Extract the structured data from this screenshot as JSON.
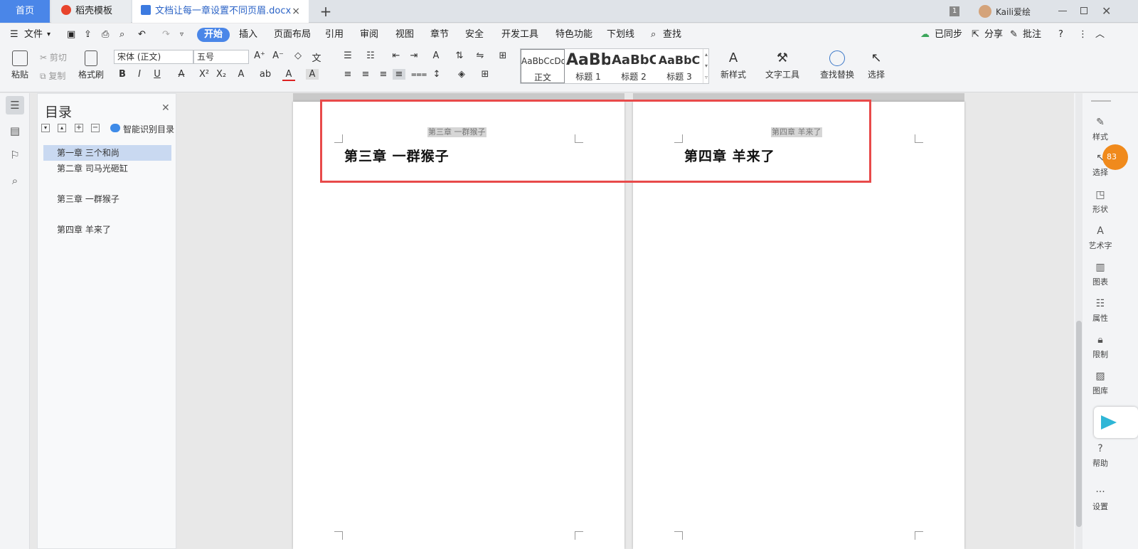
{
  "tabs": {
    "home": "首页",
    "templates": "稻壳模板",
    "document": "文档让每一章设置不同页眉.docx",
    "close": "×",
    "new_tab": "+"
  },
  "titlebar": {
    "badge": "1",
    "user": "Kaili爱绘"
  },
  "menu": {
    "file": "文件",
    "items": [
      "开始",
      "插入",
      "页面布局",
      "引用",
      "审阅",
      "视图",
      "章节",
      "安全",
      "开发工具",
      "特色功能",
      "下划线"
    ],
    "search": "查找",
    "sync": "已同步",
    "share": "分享",
    "comment": "批注"
  },
  "ribbon": {
    "paste": "粘贴",
    "cut": "剪切",
    "copy": "复制",
    "format_painter": "格式刷",
    "font_name": "宋体 (正文)",
    "font_size": "五号",
    "styles": [
      {
        "preview": "AaBbCcDd",
        "label": "正文"
      },
      {
        "preview": "AaBb",
        "label": "标题 1"
      },
      {
        "preview": "AaBbC",
        "label": "标题 2"
      },
      {
        "preview": "AaBbC",
        "label": "标题 3"
      }
    ],
    "new_style": "新样式",
    "text_tools": "文字工具",
    "find_replace": "查找替换",
    "select": "选择"
  },
  "toc": {
    "title": "目录",
    "smart": "智能识别目录",
    "items": [
      "第一章  三个和尚",
      "第二章  司马光砸缸",
      "第三章  一群猴子",
      "第四章  羊来了"
    ]
  },
  "pages": [
    {
      "header": "第三章  一群猴子",
      "heading": "第三章  一群猴子"
    },
    {
      "header": "第四章  羊来了",
      "heading": "第四章  羊来了"
    }
  ],
  "rightbar": {
    "tools": [
      "样式",
      "选择",
      "形状",
      "艺术字",
      "图表",
      "属性",
      "限制",
      "图库",
      "帮助",
      "设置"
    ],
    "badge": "83"
  },
  "colors": {
    "accent": "#4a86e8",
    "highlight_box": "#e84a4a",
    "toc_selected": "#c9d9f1"
  }
}
